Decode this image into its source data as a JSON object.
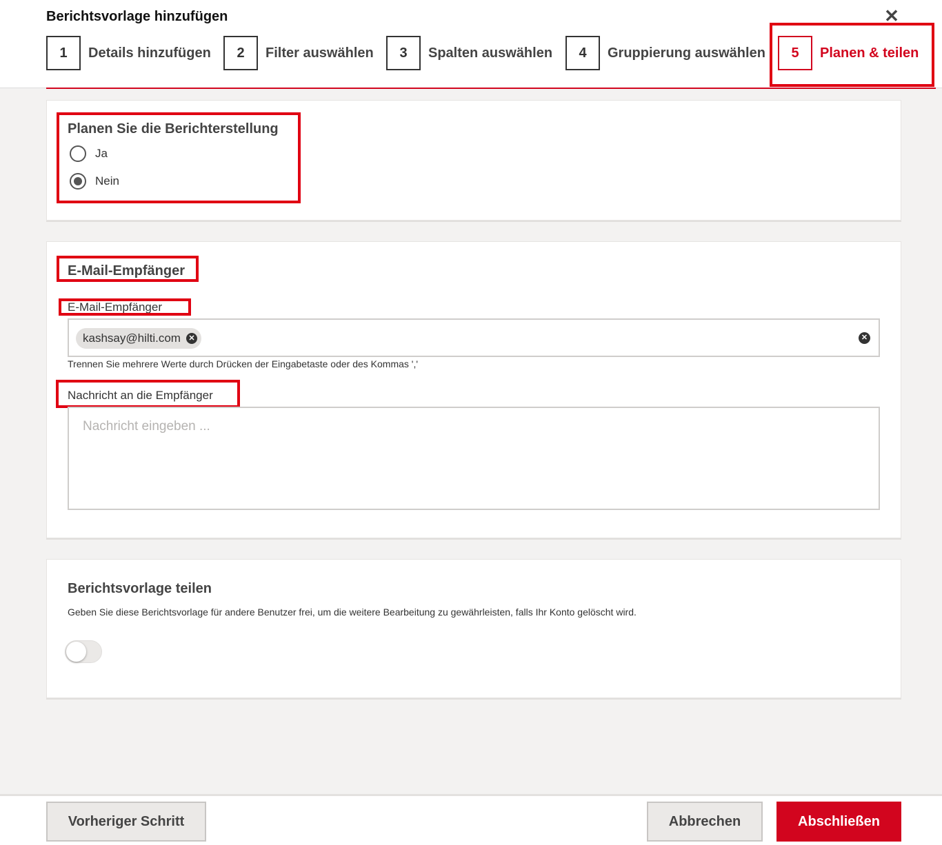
{
  "dialog": {
    "title": "Berichtsvorlage hinzufügen",
    "close_icon": "close-icon"
  },
  "steps": [
    {
      "number": "1",
      "label": "Details hinzufügen",
      "active": false
    },
    {
      "number": "2",
      "label": "Filter auswählen",
      "active": false
    },
    {
      "number": "3",
      "label": "Spalten auswählen",
      "active": false
    },
    {
      "number": "4",
      "label": "Gruppierung auswählen",
      "active": false
    },
    {
      "number": "5",
      "label": "Planen & teilen",
      "active": true
    }
  ],
  "schedule": {
    "title": "Planen Sie die Berichterstellung",
    "options": [
      {
        "label": "Ja",
        "checked": false
      },
      {
        "label": "Nein",
        "checked": true
      }
    ]
  },
  "email": {
    "section_title": "E-Mail-Empfänger",
    "recipients_label": "E-Mail-Empfänger",
    "recipients": [
      "kashsay@hilti.com"
    ],
    "hint": "Trennen Sie mehrere Werte durch Drücken der Eingabetaste oder des Kommas ','",
    "message_label": "Nachricht an die Empfänger",
    "message_placeholder": "Nachricht eingeben ...",
    "message_value": ""
  },
  "share": {
    "title": "Berichtsvorlage teilen",
    "description": "Geben Sie diese Berichtsvorlage für andere Benutzer frei, um die weitere Bearbeitung zu gewährleisten, falls Ihr Konto gelöscht wird.",
    "enabled": false
  },
  "footer": {
    "previous_label": "Vorheriger Schritt",
    "cancel_label": "Abbrechen",
    "finish_label": "Abschließen"
  },
  "colors": {
    "accent": "#d2051e",
    "annotation_box": "#e00012"
  }
}
